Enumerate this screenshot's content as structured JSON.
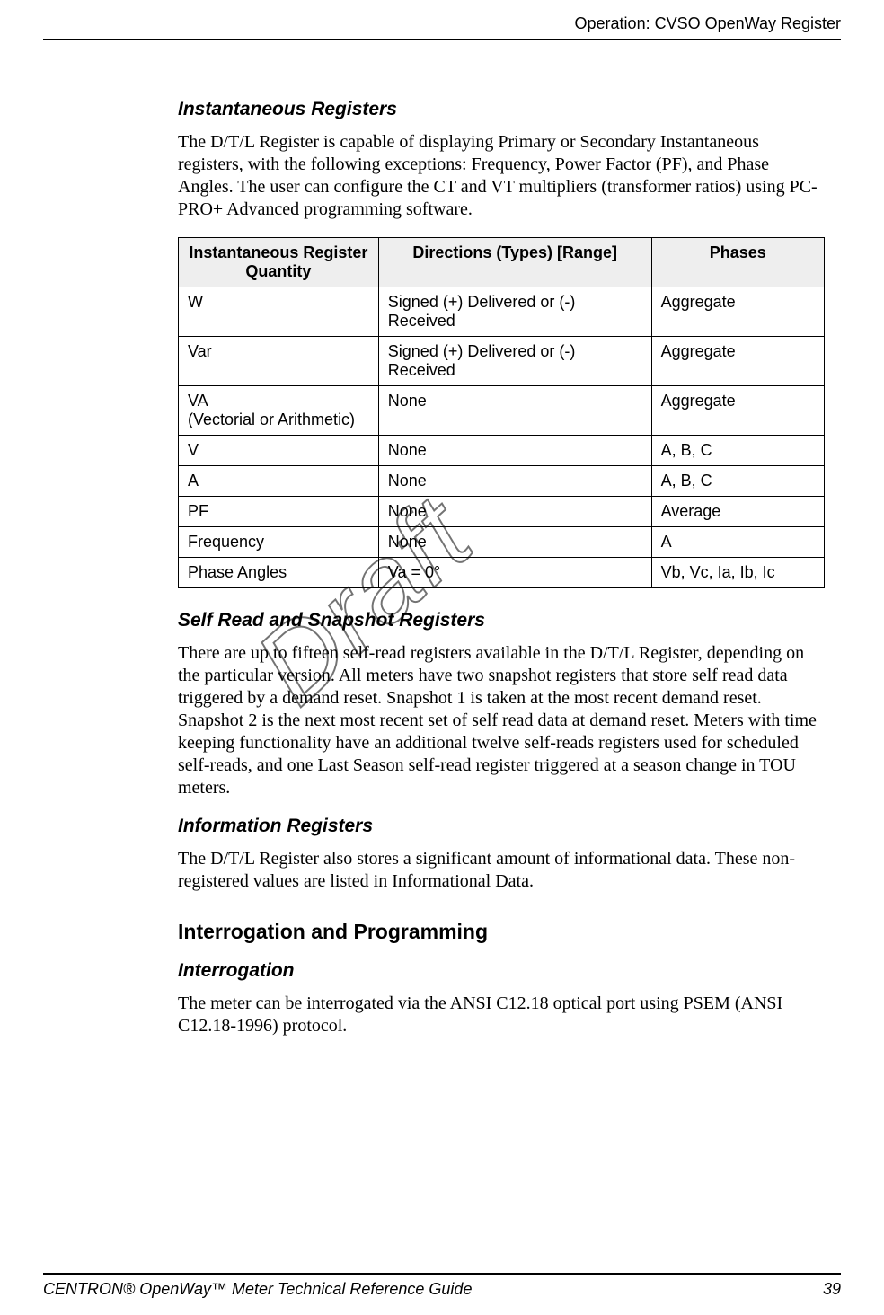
{
  "header": {
    "running_title": "Operation: CVSO OpenWay Register"
  },
  "watermark": "Draft",
  "sections": {
    "inst_reg": {
      "title": "Instantaneous Registers",
      "para": "The  D/T/L Register is capable of displaying Primary or Secondary Instantaneous registers, with the following exceptions: Frequency, Power Factor (PF), and Phase Angles. The user can configure the CT and VT multipliers (transformer ratios) using PC-PRO+ Advanced programming software."
    },
    "table": {
      "headers": {
        "c1": "Instantaneous Register Quantity",
        "c2": "Directions (Types) [Range]",
        "c3": "Phases"
      },
      "rows": [
        {
          "q": "W",
          "d": "Signed (+) Delivered or (-) Received",
          "p": "Aggregate"
        },
        {
          "q": "Var",
          "d": "Signed (+) Delivered or (-) Received",
          "p": "Aggregate"
        },
        {
          "q": "VA\n(Vectorial or Arithmetic)",
          "d": "None",
          "p": "Aggregate"
        },
        {
          "q": "V",
          "d": "None",
          "p": "A, B, C"
        },
        {
          "q": "A",
          "d": "None",
          "p": "A, B, C"
        },
        {
          "q": "PF",
          "d": "None",
          "p": "Average"
        },
        {
          "q": "Frequency",
          "d": "None",
          "p": "A"
        },
        {
          "q": "Phase Angles",
          "d": "Va = 0°",
          "p": "Vb, Vc, Ia, Ib, Ic"
        }
      ]
    },
    "self_read": {
      "title": "Self Read and Snapshot Registers",
      "para": "There are up to fifteen self-read registers available in the  D/T/L Register, depending on the particular version. All meters have two snapshot registers that store self read data triggered by a demand reset. Snapshot 1 is taken at the most recent demand reset. Snapshot 2 is the next most recent set of self read data at demand reset. Meters with time keeping functionality have an additional twelve self-reads registers used for scheduled self-reads, and one Last Season self-read register triggered at a season change in TOU meters."
    },
    "info_reg": {
      "title": "Information Registers",
      "para": "The  D/T/L Register also stores a significant amount of informational data. These non-registered values are listed in Informational Data."
    },
    "interrog_prog": {
      "title": "Interrogation and Programming"
    },
    "interrogation": {
      "title": "Interrogation",
      "para": "The meter can be interrogated via the ANSI C12.18 optical port using PSEM (ANSI C12.18-1996) protocol."
    }
  },
  "footer": {
    "doc_title": "CENTRON® OpenWay™ Meter Technical Reference Guide",
    "page_number": "39"
  }
}
